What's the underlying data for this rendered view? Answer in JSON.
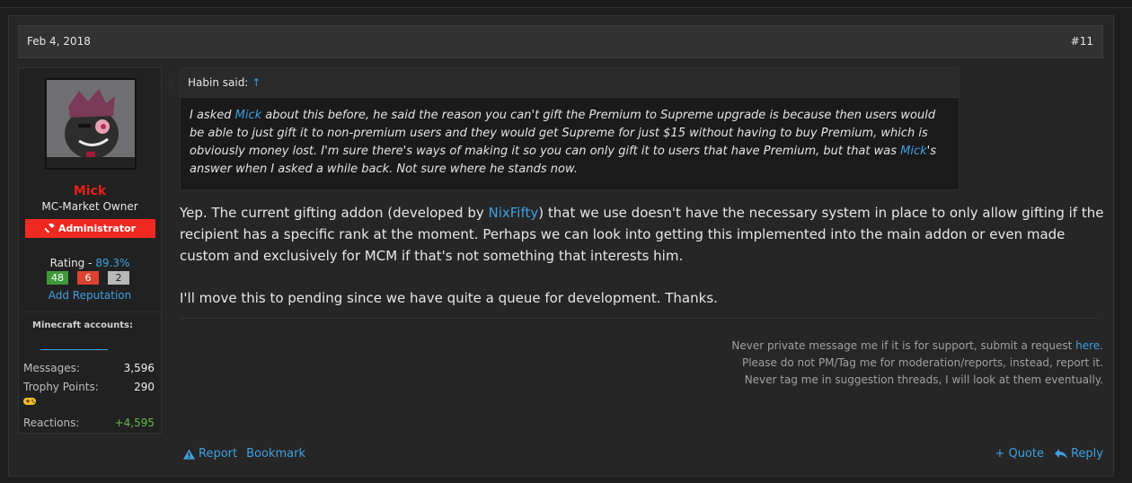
{
  "post": {
    "date": "Feb 4, 2018",
    "number": "#11"
  },
  "user": {
    "name": "Mick",
    "title": "MC-Market Owner",
    "banner": "Administrator",
    "rating_label": "Rating - ",
    "rating_pct": "89.3%",
    "rating_positive": "48",
    "rating_negative": "6",
    "rating_neutral": "2",
    "add_reputation": "Add Reputation",
    "minecraft_accounts_label": "Minecraft accounts:",
    "stats": {
      "messages_label": "Messages:",
      "messages_value": "3,596",
      "trophy_label": "Trophy Points:",
      "trophy_value": "290",
      "reactions_label": "Reactions:",
      "reactions_value": "+4,595"
    }
  },
  "quote": {
    "author": "Habin said:",
    "arrow": "↑",
    "part1": "I asked ",
    "mention1": "Mick",
    "part2": " about this before, he said the reason you can't gift the Premium to Supreme upgrade is because then users would be able to just gift it to non-premium users and they would get Supreme for just $15 without having to buy Premium, which is obviously money lost. I'm sure there's ways of making it so you can only gift it to users that have Premium, but that was ",
    "mention2": "Mick",
    "part3": "'s answer when I asked a while back. Not sure where he stands now."
  },
  "message": {
    "p1_a": "Yep. The current gifting addon (developed by ",
    "p1_link": "NixFifty",
    "p1_b": ") that we use doesn't have the necessary system in place to only allow gifting if the recipient has a specific rank at the moment. Perhaps we can look into getting this implemented into the main addon or even made custom and exclusively for MCM if that's not something that interests him.",
    "p2": "I'll move this to pending since we have quite a queue for development. Thanks."
  },
  "signature": {
    "line1_a": "Never private message me if it is for support, submit a request ",
    "line1_link": "here",
    "line1_b": ".",
    "line2": "Please do not PM/Tag me for moderation/reports, instead, report it.",
    "line3": "Never tag me in suggestion threads, I will look at them eventually."
  },
  "actions": {
    "report": "Report",
    "bookmark": "Bookmark",
    "quote": "+ Quote",
    "reply": "Reply"
  },
  "icons": {
    "banner": "gavel-icon",
    "report": "warning-icon",
    "reply": "reply-icon",
    "trophy": "gamepad-icon"
  },
  "colors": {
    "accent": "#3fa0e0",
    "username": "#e8201a",
    "admin_banner": "#f02a22",
    "reactions": "#5fbe4a"
  }
}
